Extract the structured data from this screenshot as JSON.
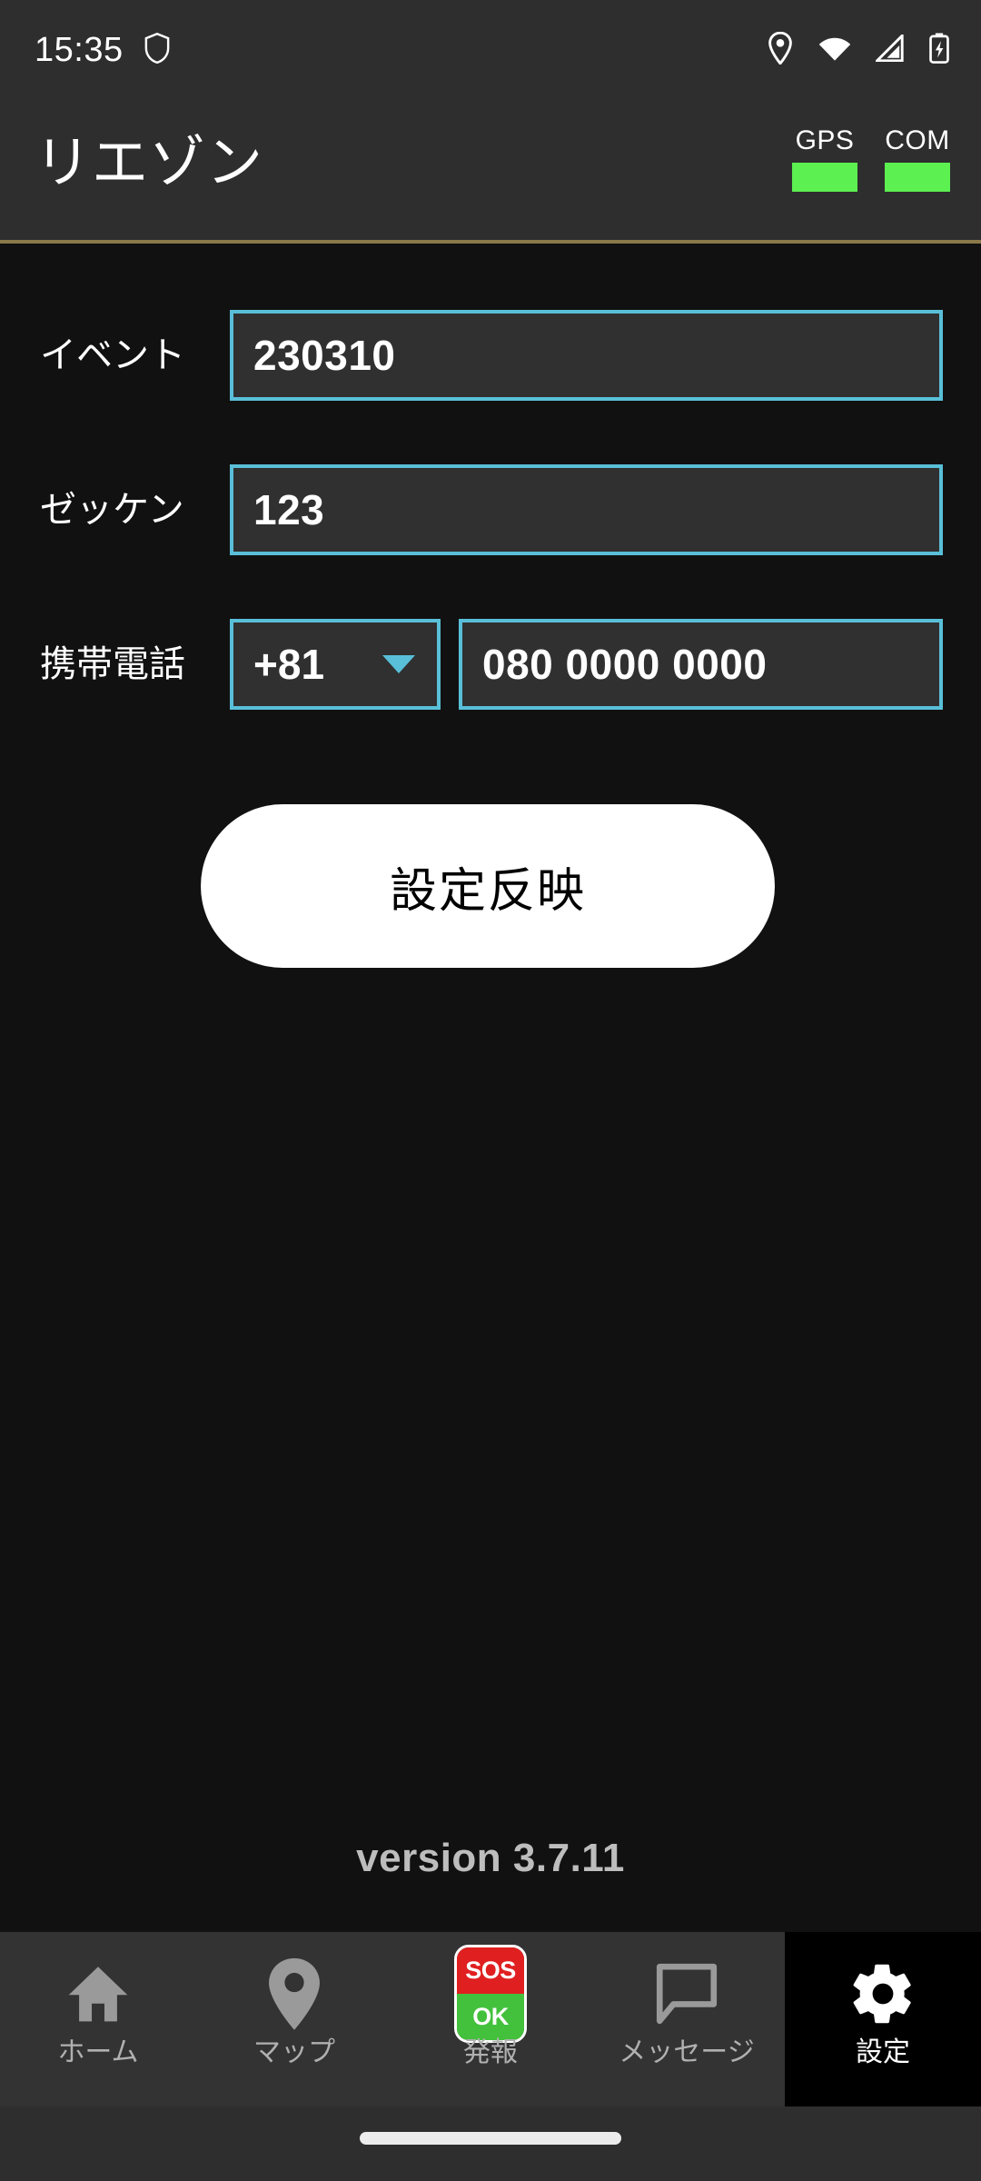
{
  "status_bar": {
    "time": "15:35",
    "icons": [
      "shield-icon",
      "location-pin-icon",
      "wifi-icon",
      "cell-signal-icon",
      "battery-charging-icon"
    ]
  },
  "app_bar": {
    "title": "リエゾン",
    "indicators": [
      {
        "label": "GPS",
        "color": "#5cf050",
        "state": "on"
      },
      {
        "label": "COM",
        "color": "#5cf050",
        "state": "on"
      }
    ],
    "divider_color": "#8a7a4a"
  },
  "form": {
    "accent_color": "#59bfd8",
    "fields": [
      {
        "label": "イベント",
        "value": "230310",
        "placeholder": ""
      },
      {
        "label": "ゼッケン",
        "value": "123",
        "placeholder": ""
      }
    ],
    "phone": {
      "label": "携帯電話",
      "country_code": "+81",
      "number": "080 0000 0000",
      "placeholder": "080 0000 0000"
    },
    "apply_button": "設定反映"
  },
  "footer": {
    "version": "version 3.7.11"
  },
  "bottom_nav": {
    "active": "設定",
    "tabs": [
      {
        "label": "ホーム",
        "icon": "home-icon"
      },
      {
        "label": "マップ",
        "icon": "map-pin-icon"
      },
      {
        "label": "発報",
        "icon": "sos-ok-icon",
        "sos_text": "SOS",
        "ok_text": "OK"
      },
      {
        "label": "メッセージ",
        "icon": "message-icon"
      },
      {
        "label": "設定",
        "icon": "gear-icon"
      }
    ]
  }
}
